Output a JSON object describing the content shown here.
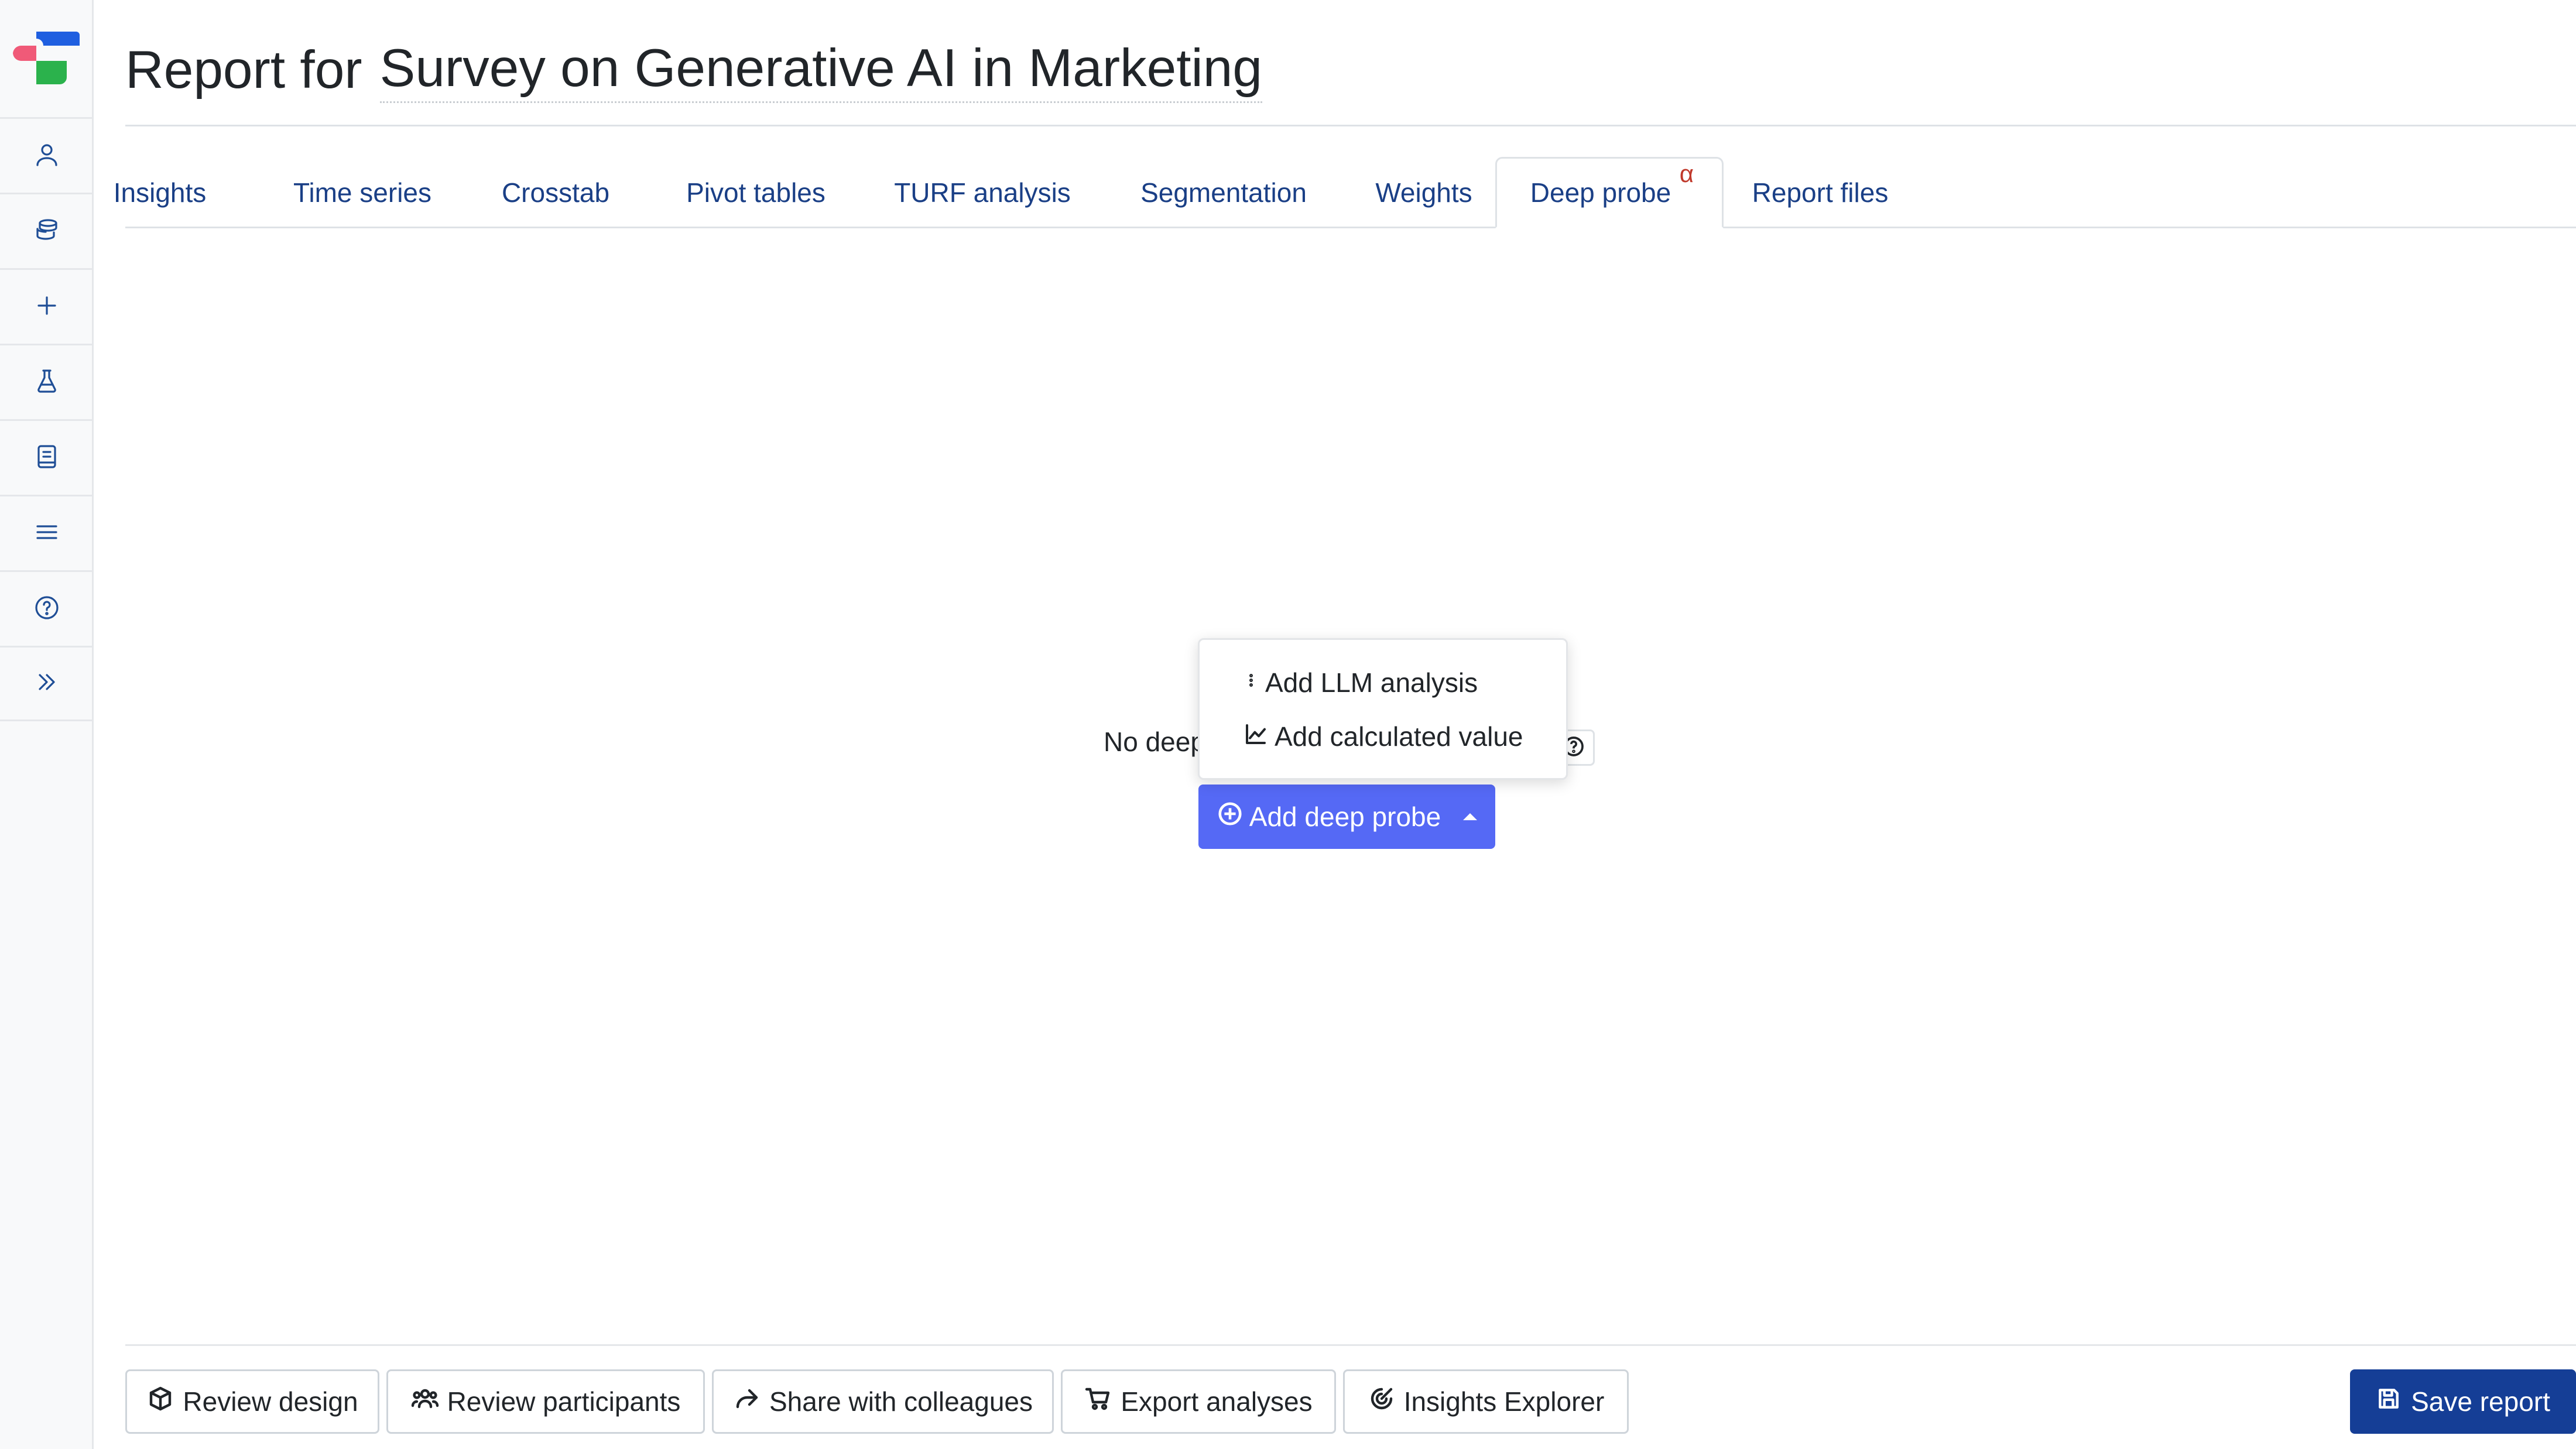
{
  "sidebar": {
    "items": [
      {
        "icon": "user-icon"
      },
      {
        "icon": "database-icon"
      },
      {
        "icon": "plus-icon"
      },
      {
        "icon": "flask-icon"
      },
      {
        "icon": "book-icon"
      },
      {
        "icon": "menu-icon"
      },
      {
        "icon": "help-icon"
      },
      {
        "icon": "expand-icon"
      }
    ]
  },
  "header": {
    "prefix": "Report for",
    "survey_name": "Survey on Generative AI in Marketing"
  },
  "tabs": [
    {
      "label": "Insights"
    },
    {
      "label": "Time series"
    },
    {
      "label": "Crosstab"
    },
    {
      "label": "Pivot tables"
    },
    {
      "label": "TURF analysis"
    },
    {
      "label": "Segmentation"
    },
    {
      "label": "Weights"
    },
    {
      "label": "Deep probe",
      "badge": "α",
      "active": true
    },
    {
      "label": "Report files"
    }
  ],
  "main": {
    "empty_text": "No deep",
    "add_button": "Add deep probe"
  },
  "dropdown": {
    "items": [
      {
        "label": "Add LLM analysis",
        "icon": "kebab-vertical-icon"
      },
      {
        "label": "Add calculated value",
        "icon": "line-chart-icon"
      }
    ]
  },
  "footer": {
    "buttons": [
      {
        "label": "Review design",
        "icon": "box-icon"
      },
      {
        "label": "Review participants",
        "icon": "people-icon"
      },
      {
        "label": "Share with colleagues",
        "icon": "share-icon"
      },
      {
        "label": "Export analyses",
        "icon": "cart-icon"
      },
      {
        "label": "Insights Explorer",
        "icon": "radar-icon"
      }
    ],
    "save": "Save report"
  },
  "colors": {
    "accent": "#5569f5",
    "primary_dark": "#153e96",
    "tab_text": "#1a3f86",
    "alpha_badge": "#c0392b"
  }
}
